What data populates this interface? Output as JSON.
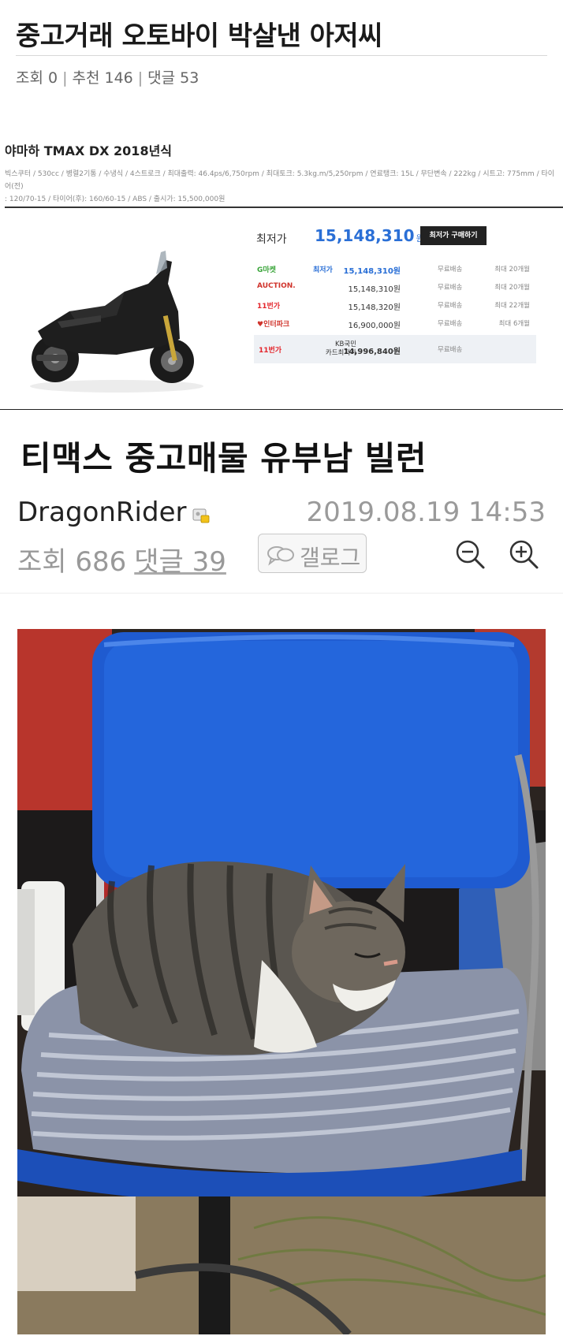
{
  "post": {
    "title": "중고거래 오토바이 박살낸 아저씨",
    "views_label": "조회 0",
    "recommend_label": "추천 146",
    "comments_label": "댓글 53",
    "separator": "|"
  },
  "product": {
    "name": "야마하 TMAX DX 2018년식",
    "specs_line1": "빅스쿠터 / 530cc / 병렬2기통 / 수냉식 / 4스트로크 / 최대출력: 46.4ps/6,750rpm / 최대토크: 5.3kg.m/5,250rpm / 연료탱크: 15L / 무단변속 / 222kg / 시트고: 775mm / 타이어(전)",
    "specs_line2": ": 120/70-15 / 타이어(후): 160/60-15 / ABS / 출시가: 15,500,000원",
    "lowest_label": "최저가",
    "lowest_price": "15,148,310",
    "won": "원",
    "buy_button": "최저가 구매하기",
    "shops": [
      {
        "logo": "G마켓",
        "logo_color": "#3aa53a",
        "tag": "최저가",
        "price": "15,148,310원",
        "ship": "무료배송",
        "installment": "최대 20개월",
        "highlight": true
      },
      {
        "logo": "AUCTION.",
        "logo_color": "#d0342c",
        "tag": "",
        "price": "15,148,310원",
        "ship": "무료배송",
        "installment": "최대 20개월",
        "highlight": false
      },
      {
        "logo": "11번가",
        "logo_color": "#e4262c",
        "tag": "",
        "price": "15,148,320원",
        "ship": "무료배송",
        "installment": "최대 22개월",
        "highlight": false
      },
      {
        "logo": "♥인터파크",
        "logo_color": "#d0342c",
        "tag": "",
        "price": "16,900,000원",
        "ship": "무료배송",
        "installment": "최대 6개월",
        "highlight": false
      }
    ],
    "card_offer": {
      "logo": "11번가",
      "tag_line1": "KB국민",
      "tag_line2": "카드최저가",
      "price": "14,996,840원",
      "ship": "무료배송"
    }
  },
  "post2": {
    "title": "티맥스 중고매물 유부남 빌런",
    "author": "DragonRider",
    "date": "2019.08.19 14:53",
    "views_label": "조회 686",
    "comments_label": "댓글 39",
    "gallog_label": "갤로그"
  },
  "colors": {
    "accent_blue": "#2a6fd6",
    "chair_blue": "#1f5bd0"
  },
  "icons": [
    "user-badge-icon",
    "chat-bubble-icon",
    "zoom-out-icon",
    "zoom-in-icon"
  ]
}
